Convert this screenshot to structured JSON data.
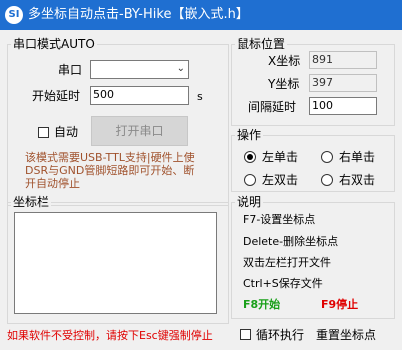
{
  "window": {
    "title": "多坐标自动点击-BY-Hike【嵌入式.h】",
    "icon": "app-icon",
    "icon_text": "SI"
  },
  "serial": {
    "group_label": "串口模式AUTO",
    "port_label": "串口",
    "port_value": "",
    "delay_label": "开始延时",
    "delay_value": "500",
    "delay_unit": "s",
    "auto_label": "自动",
    "auto_checked": false,
    "open_button": "打开串口",
    "note_lines": [
      "该模式需要USB-TTL支持|硬件上使",
      "DSR与GND管脚短路即可开始、断",
      "开自动停止"
    ]
  },
  "mouse": {
    "group_label": "鼠标位置",
    "x_label": "X坐标",
    "x_value": "891",
    "y_label": "Y坐标",
    "y_value": "397",
    "interval_label": "间隔延时",
    "interval_value": "100"
  },
  "ops": {
    "group_label": "操作",
    "options": [
      "左单击",
      "右单击",
      "左双击",
      "右双击"
    ],
    "selected": "左单击"
  },
  "coords": {
    "group_label": "坐标栏"
  },
  "help": {
    "group_label": "说明",
    "lines": [
      "F7-设置坐标点",
      "Delete-删除坐标点",
      "双击左栏打开文件",
      "Ctrl+S保存文件"
    ],
    "start_hint": "F8开始",
    "stop_hint": "F9停止"
  },
  "footer": {
    "warning": "如果软件不受控制，请按下Esc键强制停止",
    "loop_label": "循环执行",
    "loop_checked": false,
    "reset_link": "重置坐标点"
  },
  "colors": {
    "titlebar": "#1f6fd1",
    "note": "#a0522d",
    "start": "#1aa01a",
    "stop": "#e00000",
    "warning": "#e00000"
  }
}
